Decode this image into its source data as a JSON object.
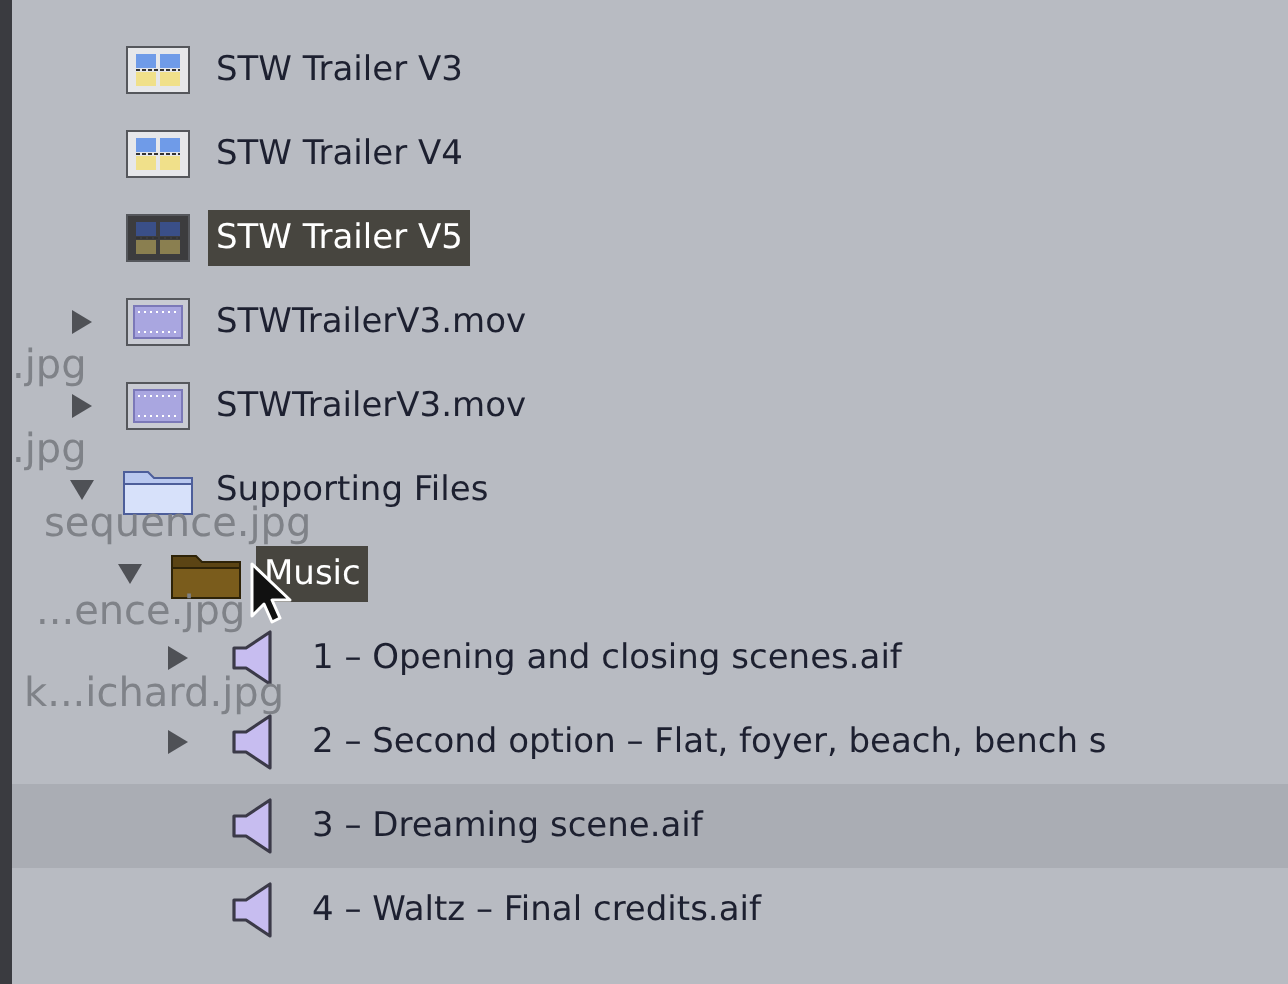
{
  "browser_items": [
    {
      "kind": "sequence",
      "label": "STW Trailer V3",
      "selected": false
    },
    {
      "kind": "sequence",
      "label": "STW Trailer V4",
      "selected": false
    },
    {
      "kind": "sequence",
      "label": "STW Trailer V5",
      "selected": true
    },
    {
      "kind": "movie",
      "label": "STWTrailerV3.mov",
      "selected": false,
      "expanded": false
    },
    {
      "kind": "movie",
      "label": "STWTrailerV3.mov",
      "selected": false,
      "expanded": false
    },
    {
      "kind": "folder",
      "label": "Supporting Files",
      "selected": false,
      "expanded": true,
      "children": [
        {
          "kind": "folder",
          "label": "Music",
          "selected": true,
          "expanded": true,
          "children": [
            {
              "kind": "audio",
              "label": "1 – Opening and closing scenes.aif",
              "selected": false,
              "highlighted": false,
              "expanded": false
            },
            {
              "kind": "audio",
              "label": "2 – Second option – Flat, foyer, beach, bench s",
              "selected": false,
              "highlighted": false,
              "expanded": false
            },
            {
              "kind": "audio",
              "label": "3 – Dreaming scene.aif",
              "selected": false,
              "highlighted": true
            },
            {
              "kind": "audio",
              "label": "4 – Waltz – Final credits.aif",
              "selected": false,
              "highlighted": false
            }
          ]
        }
      ]
    }
  ],
  "drag_ghost": {
    "labels": [
      ".jpg",
      ".jpg",
      "sequence.jpg",
      "...ence.jpg",
      "k...ichard.jpg"
    ]
  }
}
